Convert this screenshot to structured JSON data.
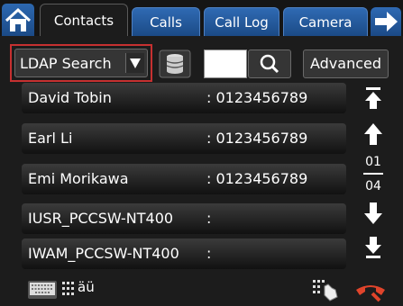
{
  "tabs": [
    {
      "label": "Contacts",
      "active": true
    },
    {
      "label": "Calls",
      "active": false
    },
    {
      "label": "Call Log",
      "active": false
    },
    {
      "label": "Camera",
      "active": false
    }
  ],
  "toolbar": {
    "search_type": "LDAP Search",
    "search_value": "",
    "advanced_label": "Advanced"
  },
  "contacts": [
    {
      "name": "David Tobin",
      "number": ": 0123456789"
    },
    {
      "name": "Earl Li",
      "number": ": 0123456789"
    },
    {
      "name": "Emi Morikawa",
      "number": ": 0123456789"
    },
    {
      "name": "IUSR_PCCSW-NT400",
      "number": ":"
    },
    {
      "name": "IWAM_PCCSW-NT400",
      "number": ":"
    }
  ],
  "pager": {
    "current": "01",
    "total": "04"
  },
  "bottom": {
    "char_label": "äü"
  },
  "icons": {
    "home": "home-icon",
    "next": "arrow-right-icon",
    "dropdown": "triangle-down-icon",
    "database": "database-icon",
    "search": "magnifier-icon",
    "first": "first-page-icon",
    "prev": "arrow-up-icon",
    "next_page": "arrow-down-icon",
    "last": "last-page-icon",
    "keyboard": "keyboard-icon",
    "keypad": "keypad-icon",
    "hand": "hand-dialpad-icon",
    "hangup": "hang-up-icon"
  },
  "colors": {
    "tab_blue": "#2f6ab3",
    "highlight_red": "#c63030",
    "hangup": "#e0442b"
  }
}
